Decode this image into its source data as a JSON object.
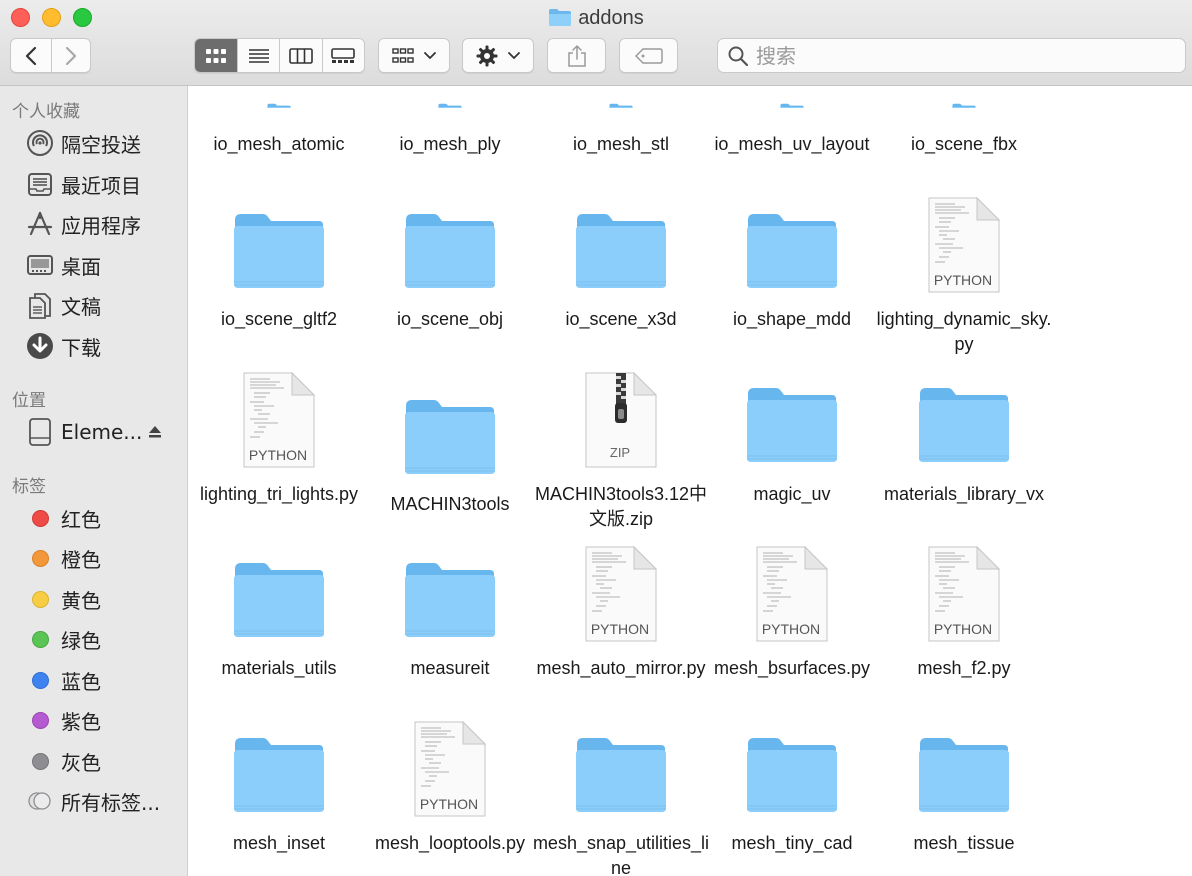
{
  "window": {
    "title": "addons"
  },
  "toolbar": {
    "back_icon": "chevron-left-icon",
    "forward_icon": "chevron-right-icon",
    "view_modes": [
      "icon-view-icon",
      "list-view-icon",
      "column-view-icon",
      "gallery-view-icon"
    ],
    "active_view": "icon-view-icon",
    "group_icon": "group-grid-icon",
    "action_icon": "gear-icon",
    "share_icon": "share-icon",
    "tag_icon": "tag-icon",
    "search_placeholder": "搜索"
  },
  "sidebar": {
    "favorites_heading": "个人收藏",
    "favorites": [
      {
        "label": "隔空投送",
        "icon": "airdrop-icon"
      },
      {
        "label": "最近项目",
        "icon": "recents-icon"
      },
      {
        "label": "应用程序",
        "icon": "applications-icon"
      },
      {
        "label": "桌面",
        "icon": "desktop-icon"
      },
      {
        "label": "文稿",
        "icon": "documents-icon"
      },
      {
        "label": "下载",
        "icon": "downloads-icon"
      }
    ],
    "locations_heading": "位置",
    "locations": [
      {
        "label": "Eleme...",
        "icon": "drive-icon",
        "eject": "eject-icon"
      }
    ],
    "tags_heading": "标签",
    "tags": [
      {
        "label": "红色",
        "color": "#ee4b47"
      },
      {
        "label": "橙色",
        "color": "#f3973b"
      },
      {
        "label": "黄色",
        "color": "#f7cd44"
      },
      {
        "label": "绿色",
        "color": "#5ac455"
      },
      {
        "label": "蓝色",
        "color": "#3f83ef"
      },
      {
        "label": "紫色",
        "color": "#b55ad0"
      },
      {
        "label": "灰色",
        "color": "#8e8e92"
      },
      {
        "label": "所有标签...",
        "color": "all-tags"
      }
    ]
  },
  "files": [
    {
      "name": "io_mesh_atomic",
      "type": "folder"
    },
    {
      "name": "io_mesh_ply",
      "type": "folder"
    },
    {
      "name": "io_mesh_stl",
      "type": "folder"
    },
    {
      "name": "io_mesh_uv_layout",
      "type": "folder"
    },
    {
      "name": "io_scene_fbx",
      "type": "folder"
    },
    {
      "name": "io_scene_gltf2",
      "type": "folder"
    },
    {
      "name": "io_scene_obj",
      "type": "folder"
    },
    {
      "name": "io_scene_x3d",
      "type": "folder"
    },
    {
      "name": "io_shape_mdd",
      "type": "folder"
    },
    {
      "name": "lighting_dynamic_sky.py",
      "type": "python",
      "badge": "PYTHON"
    },
    {
      "name": "lighting_tri_lights.py",
      "type": "python",
      "badge": "PYTHON"
    },
    {
      "name": "MACHIN3tools",
      "type": "folder"
    },
    {
      "name": "MACHIN3tools3.12中文版.zip",
      "type": "zip",
      "badge": "ZIP"
    },
    {
      "name": "magic_uv",
      "type": "folder"
    },
    {
      "name": "materials_library_vx",
      "type": "folder"
    },
    {
      "name": "materials_utils",
      "type": "folder"
    },
    {
      "name": "measureit",
      "type": "folder"
    },
    {
      "name": "mesh_auto_mirror.py",
      "type": "python",
      "badge": "PYTHON"
    },
    {
      "name": "mesh_bsurfaces.py",
      "type": "python",
      "badge": "PYTHON"
    },
    {
      "name": "mesh_f2.py",
      "type": "python",
      "badge": "PYTHON"
    },
    {
      "name": "mesh_inset",
      "type": "folder"
    },
    {
      "name": "mesh_looptools.py",
      "type": "python",
      "badge": "PYTHON"
    },
    {
      "name": "mesh_snap_utilities_line",
      "type": "folder"
    },
    {
      "name": "mesh_tiny_cad",
      "type": "folder"
    },
    {
      "name": "mesh_tissue",
      "type": "folder"
    }
  ]
}
